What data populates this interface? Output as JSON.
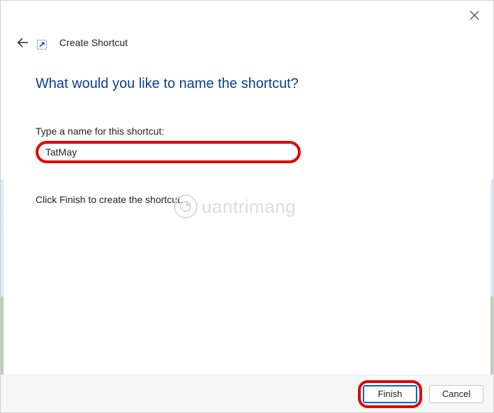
{
  "header": {
    "title": "Create Shortcut"
  },
  "main": {
    "heading": "What would you like to name the shortcut?",
    "field_label": "Type a name for this shortcut:",
    "shortcut_name": "TatMay",
    "hint": "Click Finish to create the shortcut."
  },
  "footer": {
    "finish_label": "Finish",
    "cancel_label": "Cancel"
  },
  "watermark": {
    "text": "uantrimang"
  },
  "highlight_color": "#e20000",
  "heading_color": "#0a3e8f"
}
